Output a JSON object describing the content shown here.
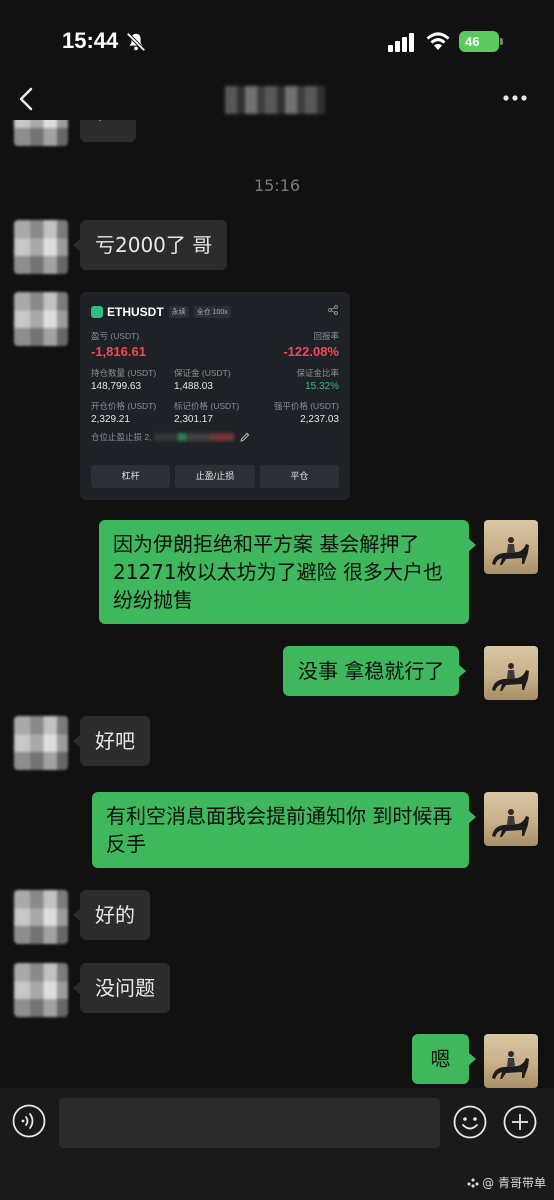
{
  "status_bar": {
    "time": "15:44",
    "battery": "46"
  },
  "header": {
    "back_icon": "chevron-left-icon",
    "more_icon": "ellipsis-icon"
  },
  "chat": {
    "partial_top_message": "？",
    "timestamp": "15:16",
    "messages": [
      {
        "side": "left",
        "text": "亏2000了 哥"
      },
      {
        "side": "right",
        "text": "因为伊朗拒绝和平方案 基会解押了21271枚以太坊为了避险 很多大户也纷纷抛售"
      },
      {
        "side": "right",
        "text": "没事 拿稳就行了"
      },
      {
        "side": "left",
        "text": "好吧"
      },
      {
        "side": "right",
        "text": "有利空消息面我会提前通知你 到时候再反手"
      },
      {
        "side": "left",
        "text": "好的"
      },
      {
        "side": "left",
        "text": "没问题"
      },
      {
        "side": "right",
        "text": "嗯"
      }
    ]
  },
  "position_card": {
    "symbol": "ETHUSDT",
    "tag_perp": "永续",
    "tag_margin": "全仓 100x",
    "pnl_label": "盈亏 (USDT)",
    "pnl_value": "-1,816.61",
    "roe_label": "回报率",
    "roe_value": "-122.08%",
    "size_label": "持仓数量 (USDT)",
    "size_value": "148,799.63",
    "margin_label": "保证金 (USDT)",
    "margin_value": "1,488.03",
    "margin_ratio_label": "保证金比率",
    "margin_ratio_value": "15.32%",
    "entry_label": "开仓价格 (USDT)",
    "entry_value": "2,329.21",
    "mark_label": "标记价格 (USDT)",
    "mark_value": "2,301.17",
    "liq_label": "强平价格 (USDT)",
    "liq_value": "2,237.03",
    "tpsl_label": "仓位止盈止损 2,",
    "btn_leverage": "杠杆",
    "btn_tpsl": "止盈/止损",
    "btn_close": "平仓"
  },
  "input_bar": {
    "placeholder": ""
  },
  "watermark": "@ 青哥带单",
  "colors": {
    "sent_bubble": "#3fb75c",
    "received_bubble": "#2c2c2c",
    "loss_red": "#f6465d",
    "gain_green": "#2ebd85"
  }
}
